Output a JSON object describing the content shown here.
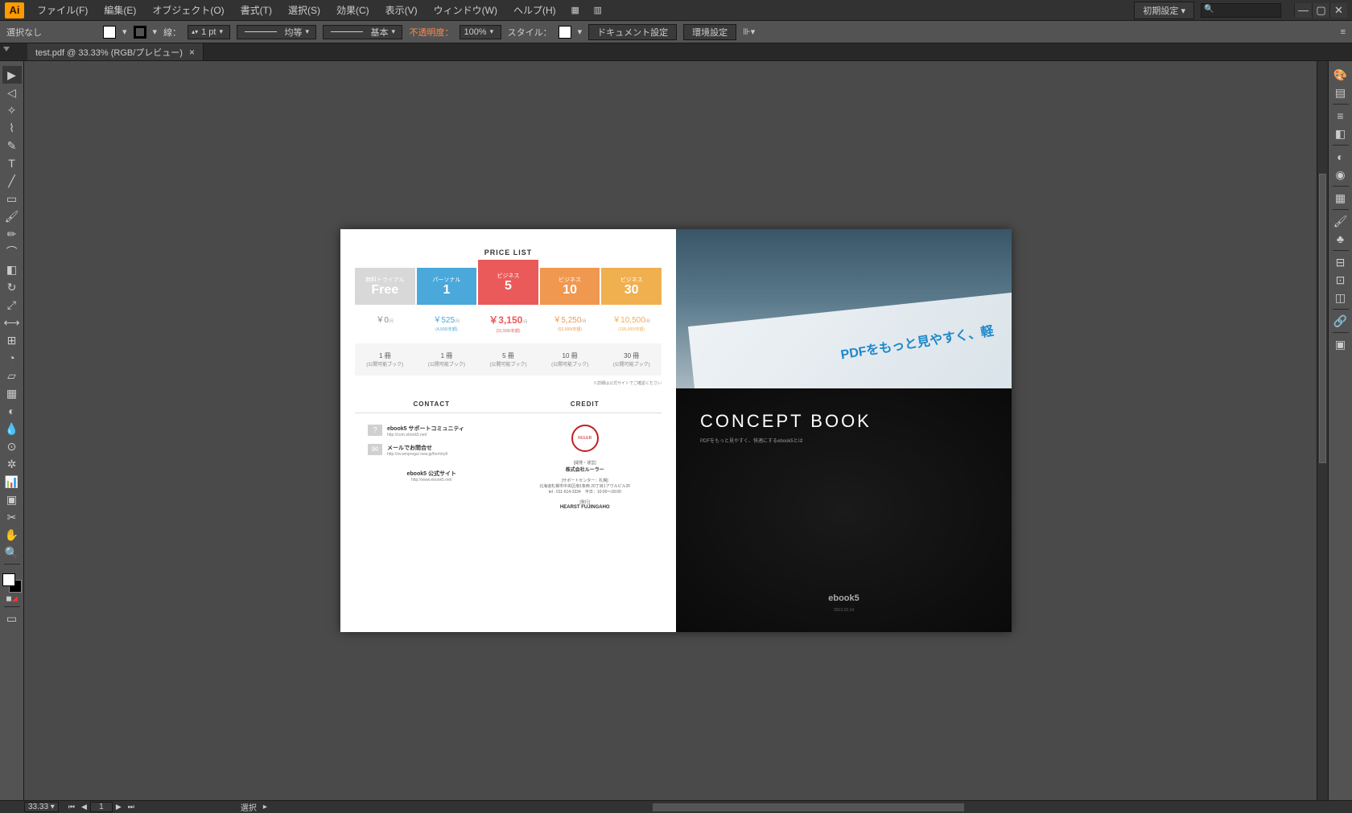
{
  "app": {
    "logo": "Ai"
  },
  "menu": {
    "items": [
      "ファイル(F)",
      "編集(E)",
      "オブジェクト(O)",
      "書式(T)",
      "選択(S)",
      "効果(C)",
      "表示(V)",
      "ウィンドウ(W)",
      "ヘルプ(H)"
    ],
    "workspace": "初期設定",
    "search_placeholder": ""
  },
  "control": {
    "selection": "選択なし",
    "stroke_label": "線：",
    "stroke_w": "1 pt",
    "dash1": "均等",
    "dash2": "基本",
    "opacity_label": "不透明度：",
    "opacity": "100%",
    "style_label": "スタイル：",
    "btn_doc": "ドキュメント設定",
    "btn_prefs": "環境設定"
  },
  "tab": {
    "label": "test.pdf @ 33.33% (RGB/プレビュー)"
  },
  "status": {
    "zoom": "33.33",
    "page": "1",
    "mode": "選択"
  },
  "doc": {
    "left": {
      "price_title": "PRICE LIST",
      "plans": [
        {
          "tier": "無料トライアル",
          "big": "Free"
        },
        {
          "tier": "パーソナル",
          "big": "1"
        },
        {
          "tier": "ビジネス",
          "big": "5"
        },
        {
          "tier": "ビジネス",
          "big": "10"
        },
        {
          "tier": "ビジネス",
          "big": "30"
        }
      ],
      "values": [
        {
          "amt": "￥0",
          "unit": "/月",
          "note": ""
        },
        {
          "amt": "￥525",
          "unit": "/月",
          "note": "(4,500/年額)"
        },
        {
          "amt": "￥3,150",
          "unit": "/月",
          "note": "(31,500/年額)"
        },
        {
          "amt": "￥5,250",
          "unit": "/月",
          "note": "(52,500/年額)"
        },
        {
          "amt": "￥10,500",
          "unit": "/月",
          "note": "(105,000/年額)"
        }
      ],
      "books": [
        {
          "n": "1 冊",
          "s": "(公開可能ブック)"
        },
        {
          "n": "1 冊",
          "s": "(公開可能ブック)"
        },
        {
          "n": "5 冊",
          "s": "(公開可能ブック)"
        },
        {
          "n": "10 冊",
          "s": "(公開可能ブック)"
        },
        {
          "n": "30 冊",
          "s": "(公開可能ブック)"
        }
      ],
      "note": "※詳細は公式サイトでご確認ください",
      "contact_title": "CONTACT",
      "contact": [
        {
          "t1": "ebook5 サポートコミュニティ",
          "t2": "http://com.ebook5.net/"
        },
        {
          "t1": "メールでお問合せ",
          "t2": "http://sv.winprogs/.new.jp/form/rp5"
        }
      ],
      "official": {
        "t1": "ebook5 公式サイト",
        "t2": "http://www.ebook5.net/"
      },
      "credit_title": "CREDIT",
      "credits": [
        {
          "h": "[開発・運営]",
          "b": "株式会社ルーラー"
        },
        {
          "h": "[サポートセンター：札幌]",
          "b": "北海道札幌市中央区南1条西 20丁目1アウルビル2F\ntel : 011-614-3334　平日：10:00〜18:00"
        },
        {
          "h": "[発行]",
          "b": "HEARST FUJINGAHO"
        }
      ]
    },
    "right": {
      "tablet_text": "PDFをもっと見やすく、軽",
      "title": "CONCEPT BOOK",
      "subtitle": "PDFをもっと見やすく、快適にするebook5とは",
      "brand": "ebook5",
      "date": "2013.10.14"
    }
  }
}
